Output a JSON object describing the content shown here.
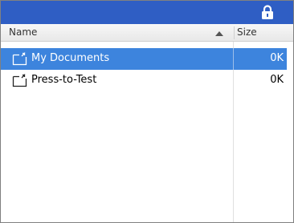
{
  "header": {
    "name_label": "Name",
    "size_label": "Size"
  },
  "files": [
    {
      "name": "My Documents",
      "size": "0K",
      "selected": true
    },
    {
      "name": "Press-to-Test",
      "size": "0K",
      "selected": false
    }
  ],
  "colors": {
    "titlebar": "#2f5ec4",
    "selection": "#3d84dd"
  },
  "icons": [
    "lock-icon",
    "folder-icon"
  ]
}
